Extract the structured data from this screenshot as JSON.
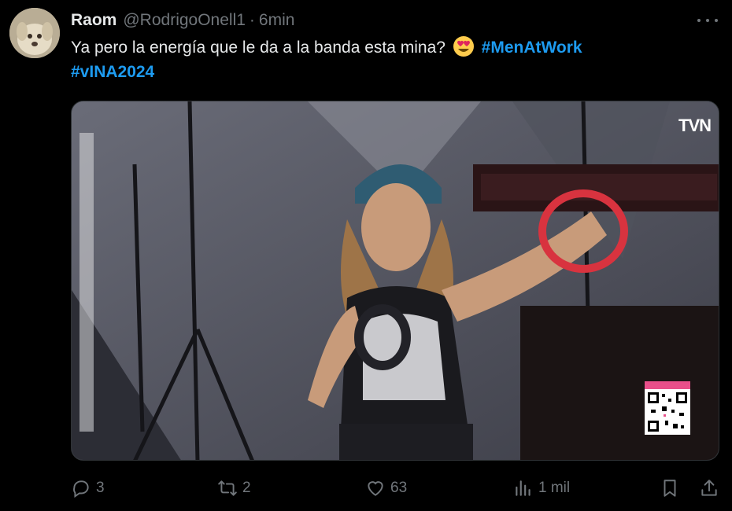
{
  "tweet": {
    "author_name": "Raom",
    "author_handle": "@RodrigoOnell1",
    "separator": "·",
    "timestamp": "6min",
    "text_part1": "Ya pero la energía que le da a la banda esta mina?",
    "hashtag1": "#MenAtWork",
    "hashtag2": "#vINA2024",
    "emoji": "heart-eyes-emoji"
  },
  "media": {
    "broadcaster_logo": "TVN",
    "qr_badge": "qr-code-icon"
  },
  "actions": {
    "replies": "3",
    "retweets": "2",
    "likes": "63",
    "views": "1 mil"
  },
  "colors": {
    "background": "#000000",
    "text_primary": "#e7e9ea",
    "text_secondary": "#71767b",
    "accent": "#1d9bf0"
  }
}
